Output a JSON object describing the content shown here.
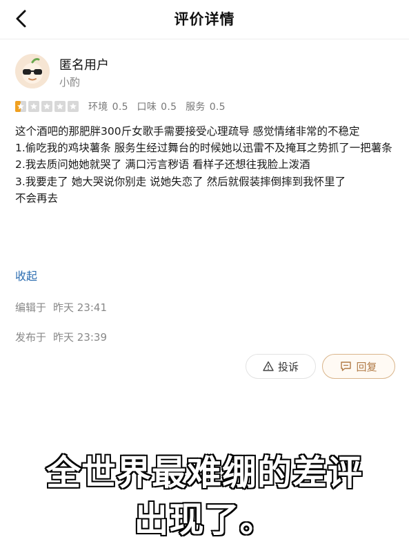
{
  "nav": {
    "title": "评价详情"
  },
  "user": {
    "name": "匿名用户",
    "tag": "小酌"
  },
  "rating": {
    "stars_filled_fraction": 0.1,
    "env_label": "环境",
    "env_score": "0.5",
    "taste_label": "口味",
    "taste_score": "0.5",
    "service_label": "服务",
    "service_score": "0.5"
  },
  "review": {
    "lines": [
      "这个酒吧的那肥胖300斤女歌手需要接受心理疏导 感觉情绪非常的不稳定",
      "1.偷吃我的鸡块薯条 服务生经过舞台的时候她以迅雷不及掩耳之势抓了一把薯条",
      "2.我去质问她她就哭了 满口污言秽语 看样子还想往我脸上泼酒",
      "3.我要走了 她大哭说你别走 说她失恋了 然后就假装摔倒摔到我怀里了",
      "不会再去"
    ],
    "collapse_label": "收起"
  },
  "meta": {
    "edited_label": "编辑于",
    "edited_time": "昨天 23:41",
    "posted_label": "发布于",
    "posted_time": "昨天 23:39"
  },
  "actions": {
    "report_label": "投诉",
    "reply_label": "回复"
  },
  "caption": {
    "line1": "全世界最难绷的差评",
    "line2": "出现了。"
  },
  "colors": {
    "link": "#2b6cb0",
    "star_active": "#f0a020",
    "star_inactive": "#d8d8d8",
    "reply_accent": "#b07a45"
  }
}
